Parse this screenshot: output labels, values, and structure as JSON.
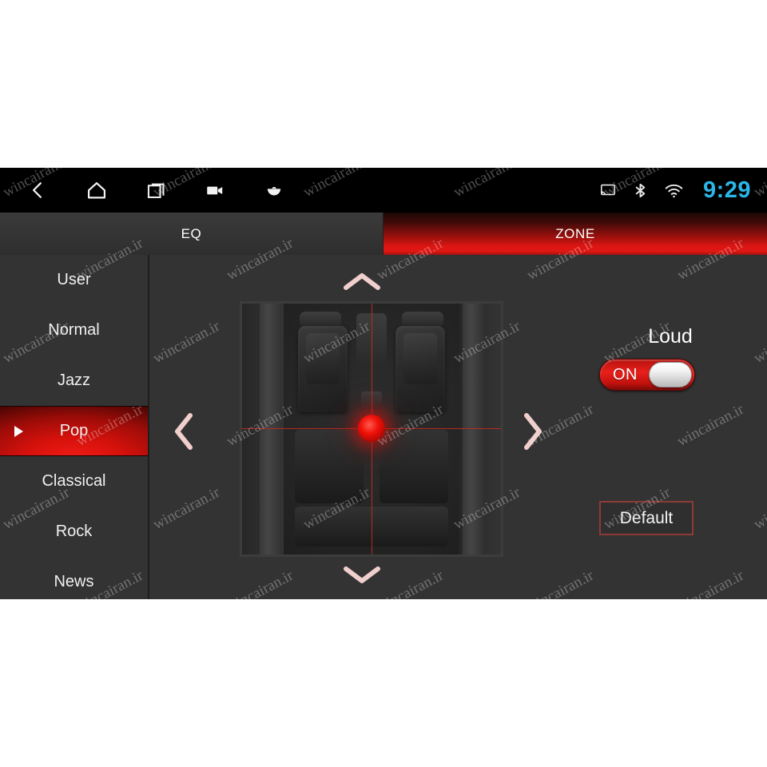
{
  "statusbar": {
    "nav": [
      {
        "name": "back-icon",
        "label": "Back"
      },
      {
        "name": "home-icon",
        "label": "Home"
      },
      {
        "name": "recents-icon",
        "label": "Recent apps"
      },
      {
        "name": "camera-icon",
        "label": "Camera"
      },
      {
        "name": "apps-icon",
        "label": "Apps"
      }
    ],
    "system": [
      {
        "name": "cast-icon",
        "label": "Cast"
      },
      {
        "name": "bluetooth-icon",
        "label": "Bluetooth"
      },
      {
        "name": "wifi-icon",
        "label": "Wi-Fi"
      }
    ],
    "clock": "9:29",
    "clock_color": "#2bb6e8"
  },
  "tabs": [
    {
      "label": "EQ",
      "active": false
    },
    {
      "label": "ZONE",
      "active": true
    }
  ],
  "presets": {
    "items": [
      {
        "label": "User",
        "selected": false
      },
      {
        "label": "Normal",
        "selected": false
      },
      {
        "label": "Jazz",
        "selected": false
      },
      {
        "label": "Pop",
        "selected": true
      },
      {
        "label": "Classical",
        "selected": false
      },
      {
        "label": "Rock",
        "selected": false
      },
      {
        "label": "News",
        "selected": false
      }
    ],
    "selected": "Pop"
  },
  "zone": {
    "up_label": "Move zone up",
    "down_label": "Move zone down",
    "left_label": "Move zone left",
    "right_label": "Move zone right",
    "focus_position": "center",
    "image_label": "Car interior top view"
  },
  "controls": {
    "loud_label": "Loud",
    "loud_state": "ON",
    "default_label": "Default"
  },
  "colors": {
    "accent_red": "#e01814",
    "background": "#333333",
    "statusbar": "#000000",
    "chevron": "#f0cfcc",
    "button_border": "#8d3a37"
  },
  "watermark": {
    "text": "wincairan.ir"
  }
}
